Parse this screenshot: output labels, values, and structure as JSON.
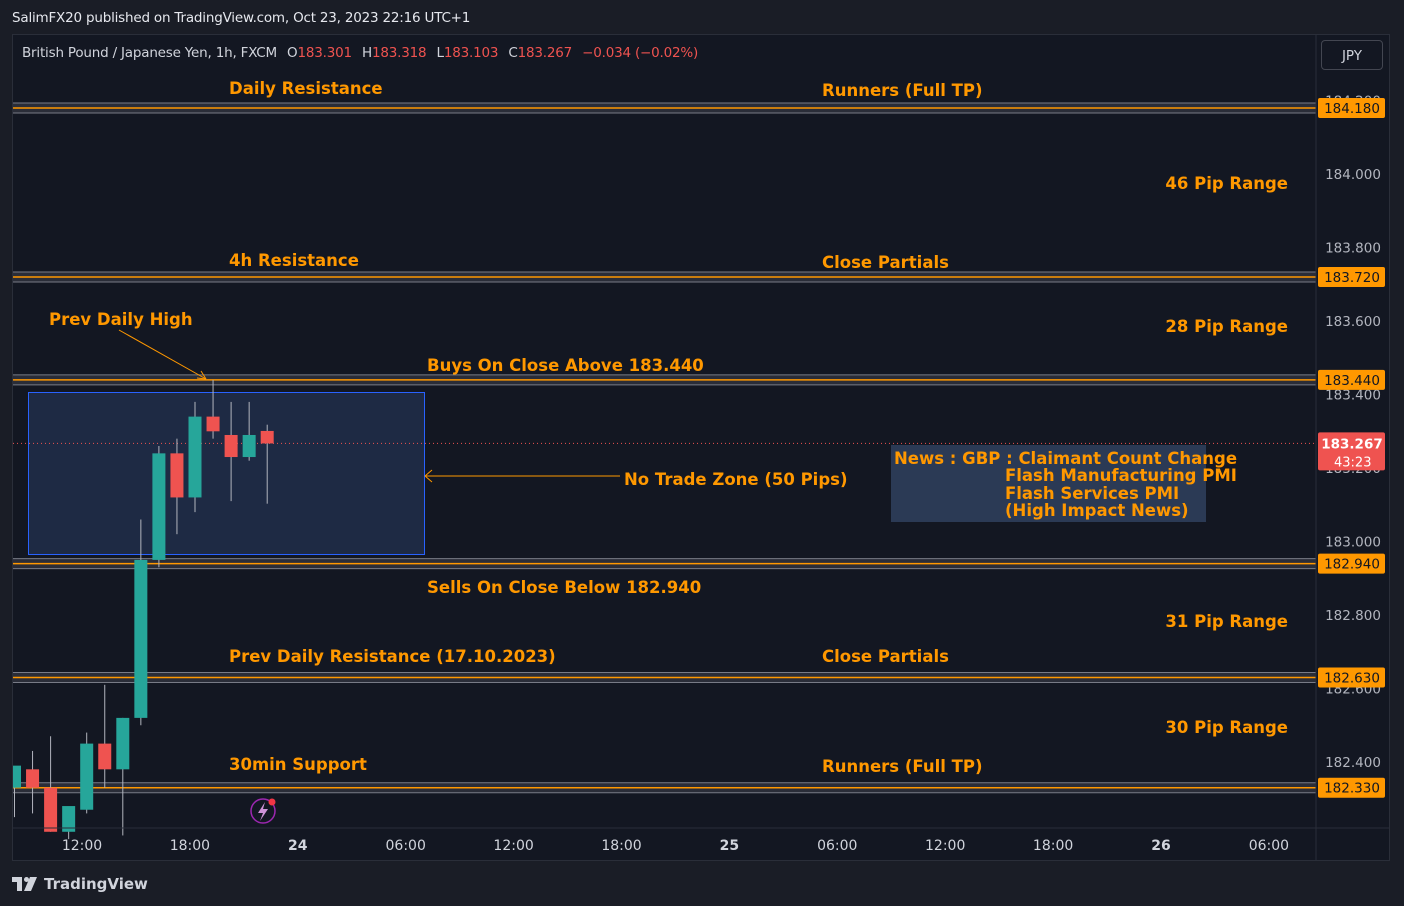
{
  "header": {
    "published_by": "SalimFX20 published on TradingView.com, Oct 23, 2023 22:16 UTC+1"
  },
  "legend": {
    "symbol": "British Pound / Japanese Yen, 1h, FXCM",
    "o_label": "O",
    "o_value": "183.301",
    "h_label": "H",
    "h_value": "183.318",
    "l_label": "L",
    "l_value": "183.103",
    "c_label": "C",
    "c_value": "183.267",
    "change": "−0.034 (−0.02%)"
  },
  "currency_button": "JPY",
  "footer": {
    "brand": "TradingView"
  },
  "colors": {
    "background": "#131722",
    "level_line": "#ff9800",
    "level_label_bg": "#ff9800",
    "annotation_text": "#ff9800",
    "bull": "#26a69a",
    "bear": "#ef5350",
    "zone_fill": "#1e2a44",
    "zone_border": "#2962ff"
  },
  "chart_data": {
    "type": "candlestick",
    "ylim": [
      182.18,
      184.26
    ],
    "y_ticks": [
      "182.400",
      "182.600",
      "182.800",
      "183.000",
      "183.200",
      "183.400",
      "183.600",
      "183.800",
      "184.000",
      "184.200"
    ],
    "x_ticks": [
      "12:00",
      "18:00",
      "24",
      "06:00",
      "12:00",
      "18:00",
      "25",
      "06:00",
      "12:00",
      "18:00",
      "26",
      "06:00"
    ],
    "x_ticks_bold": [
      false,
      false,
      true,
      false,
      false,
      false,
      true,
      false,
      false,
      false,
      true,
      false
    ],
    "candles": [
      {
        "o": 182.33,
        "h": 182.38,
        "l": 182.25,
        "c": 182.39
      },
      {
        "o": 182.38,
        "h": 182.43,
        "l": 182.26,
        "c": 182.33
      },
      {
        "o": 182.33,
        "h": 182.47,
        "l": 182.21,
        "c": 182.21
      },
      {
        "o": 182.21,
        "h": 182.26,
        "l": 182.19,
        "c": 182.28
      },
      {
        "o": 182.27,
        "h": 182.48,
        "l": 182.26,
        "c": 182.45
      },
      {
        "o": 182.45,
        "h": 182.61,
        "l": 182.33,
        "c": 182.38
      },
      {
        "o": 182.38,
        "h": 182.52,
        "l": 182.2,
        "c": 182.52
      },
      {
        "o": 182.52,
        "h": 183.06,
        "l": 182.5,
        "c": 182.95
      },
      {
        "o": 182.95,
        "h": 183.26,
        "l": 182.93,
        "c": 183.24
      },
      {
        "o": 183.24,
        "h": 183.28,
        "l": 183.02,
        "c": 183.12
      },
      {
        "o": 183.12,
        "h": 183.38,
        "l": 183.08,
        "c": 183.34
      },
      {
        "o": 183.34,
        "h": 183.44,
        "l": 183.28,
        "c": 183.3
      },
      {
        "o": 183.29,
        "h": 183.38,
        "l": 183.11,
        "c": 183.23
      },
      {
        "o": 183.23,
        "h": 183.38,
        "l": 183.22,
        "c": 183.29
      },
      {
        "o": 183.301,
        "h": 183.318,
        "l": 183.103,
        "c": 183.267
      }
    ],
    "levels": [
      {
        "price": 184.18,
        "label": "184.180"
      },
      {
        "price": 183.72,
        "label": "183.720"
      },
      {
        "price": 183.44,
        "label": "183.440"
      },
      {
        "price": 182.94,
        "label": "182.940"
      },
      {
        "price": 182.63,
        "label": "182.630"
      },
      {
        "price": 182.33,
        "label": "182.330"
      }
    ],
    "current_price": {
      "label": "183.267",
      "countdown": "43:23"
    },
    "zone_label": "No Trade Zone (50 Pips)",
    "annotations": {
      "daily_resistance": "Daily Resistance",
      "runners_top": "Runners (Full TP)",
      "pip46": "46 Pip Range",
      "h4_resistance": "4h Resistance",
      "close_partials_top": "Close Partials",
      "prev_daily_high": "Prev Daily High",
      "pip28": "28 Pip Range",
      "buys": "Buys On Close Above 183.440",
      "sells": "Sells On Close Below 182.940",
      "pip31": "31 Pip Range",
      "prev_daily_res": "Prev Daily Resistance (17.10.2023)",
      "close_partials_bottom": "Close Partials",
      "pip30": "30 Pip Range",
      "support_30min": "30min Support",
      "runners_bottom": "Runners (Full TP)"
    },
    "news": {
      "line1": "News : GBP : Claimant Count Change",
      "line2": "Flash Manufacturing PMI",
      "line3": "Flash Services PMI",
      "line4": "(High Impact News)"
    }
  }
}
